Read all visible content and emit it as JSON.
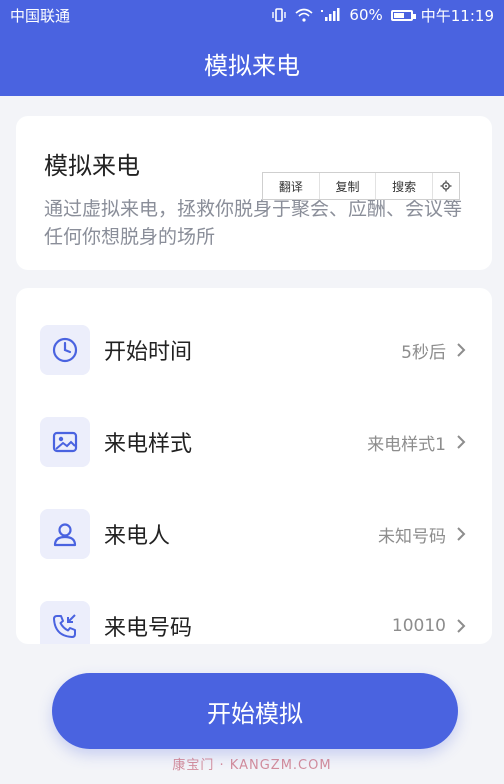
{
  "status_bar": {
    "carrier": "中国联通",
    "battery": "60%",
    "battery_level": 0.6,
    "time": "中午11:19"
  },
  "header": {
    "title": "模拟来电"
  },
  "intro": {
    "title": "模拟来电",
    "description": "通过虚拟来电，拯救你脱身于聚会、应酬、会议等任何你想脱身的场所"
  },
  "context_menu": {
    "translate": "翻译",
    "copy": "复制",
    "search": "搜索",
    "settings_icon": "gear-icon"
  },
  "settings": [
    {
      "label": "开始时间",
      "value": "5秒后",
      "icon": "clock-icon"
    },
    {
      "label": "来电样式",
      "value": "来电样式1",
      "icon": "image-icon"
    },
    {
      "label": "来电人",
      "value": "未知号码",
      "icon": "person-icon"
    },
    {
      "label": "来电号码",
      "value": "10010",
      "icon": "incoming-call-icon"
    }
  ],
  "start_button": {
    "label": "开始模拟"
  },
  "watermark": "康宝门 · KANGZM.COM",
  "colors": {
    "primary": "#4a63e0",
    "icon_bg": "#eceefb",
    "icon_stroke": "#4a63e0"
  }
}
